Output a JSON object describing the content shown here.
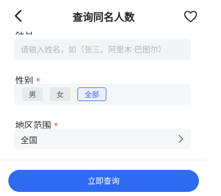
{
  "header": {
    "title": "查询同名人数",
    "back_icon": "chevron-left-icon",
    "favorite_icon": "heart-outline-icon"
  },
  "name_field": {
    "label": "姓名",
    "required_mark": "*",
    "placeholder": "请输入姓名，如（张三、阿里木·巴图尔）",
    "value": ""
  },
  "gender_field": {
    "label": "性别",
    "required_mark": "*",
    "options": [
      "男",
      "女",
      "全部"
    ],
    "selected": "全部"
  },
  "region_field": {
    "label": "地区范围",
    "required_mark": "*",
    "value": "全国",
    "chevron_icon": "chevron-right-icon"
  },
  "submit": {
    "label": "立即查询"
  },
  "colors": {
    "accent": "#2f6af2",
    "required": "#e53935",
    "selected_chip_bg": "#eaf0ff",
    "field_bg": "#f5f6f8"
  }
}
